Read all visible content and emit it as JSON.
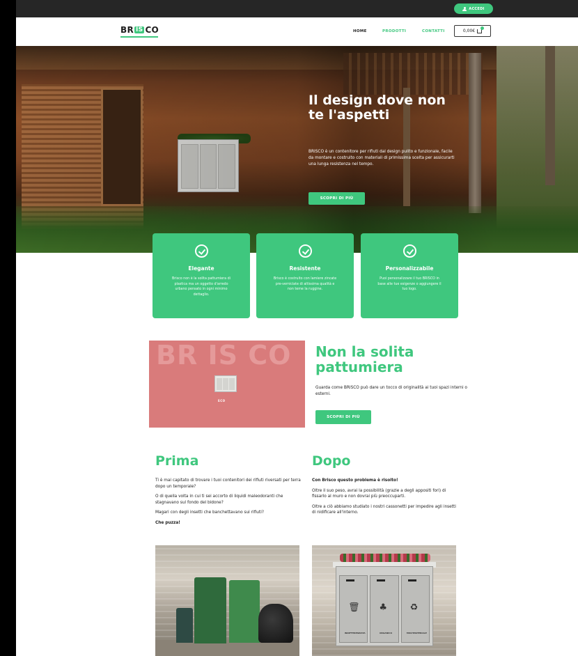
{
  "topbar": {
    "login_label": "ACCEDI"
  },
  "nav": {
    "logo_left": "BR",
    "logo_mid": "IS",
    "logo_right": "CO",
    "links": [
      "HOME",
      "PRODOTTI",
      "CONTATTI"
    ],
    "cart_total": "0,00€"
  },
  "hero": {
    "title": "Il design dove non te l'aspetti",
    "text": "BRISCO è un contenitore per rifiuti dal design pulito e funzionale, facile da montare e costruito con materiali di primissima scelta per assicurarti una lunga resistenza nel tempo.",
    "cta": "SCOPRI DI PIÙ"
  },
  "features": [
    {
      "title": "Elegante",
      "text": "Brisco non è la solita pattumiera di plastica ma un oggetto d'arredo urbano pensato in ogni minimo dettaglio."
    },
    {
      "title": "Resistente",
      "text": "Brisco è costruito con lamiere zincate pre-verniciate di altissima qualità e non teme la ruggine."
    },
    {
      "title": "Personalizzabile",
      "text": "Puoi personalizzare il tuo BRISCO in base alle tue esigenze o aggiungere il tuo logo."
    }
  ],
  "promo": {
    "bg_text": "BR IS CO",
    "caption": "ECO",
    "title": "Non la solita pattumiera",
    "text": "Guarda come BRISCO può dare un tocco di originalità ai tuoi spazi interni o esterni.",
    "cta": "SCOPRI DI PIÙ"
  },
  "prima": {
    "title": "Prima",
    "paragraphs": [
      "Ti è mai capitato di trovare i tuoi contenitori dei rifiuti riversati per terra dopo un temporale?",
      "O di quella volta in cui ti sei accorto di liquidi maleodoranti che stagnavano sul fondo del bidone?",
      "Magari con degli insetti che banchettavano sui rifiuti?",
      "Che puzza!"
    ]
  },
  "dopo": {
    "title": "Dopo",
    "paragraphs": [
      "Con Brisco questo problema è risolto!",
      "Oltre il suo peso, avrai la possibilità (grazie a degli appositi fori) di fissarlo al muro e non dovrai più preoccuparti.",
      "Oltre a ciò abbiamo studiato i nostri cassonetti per impedire agli insetti di nidificare all'interno."
    ],
    "bin_labels": [
      "INDIFFERENZIATA",
      "ORGANICO",
      "MULTIMATERIALE"
    ]
  },
  "colors": {
    "accent": "#3fc77e",
    "promo_bg": "#d97b7b",
    "topbar": "#262626"
  }
}
